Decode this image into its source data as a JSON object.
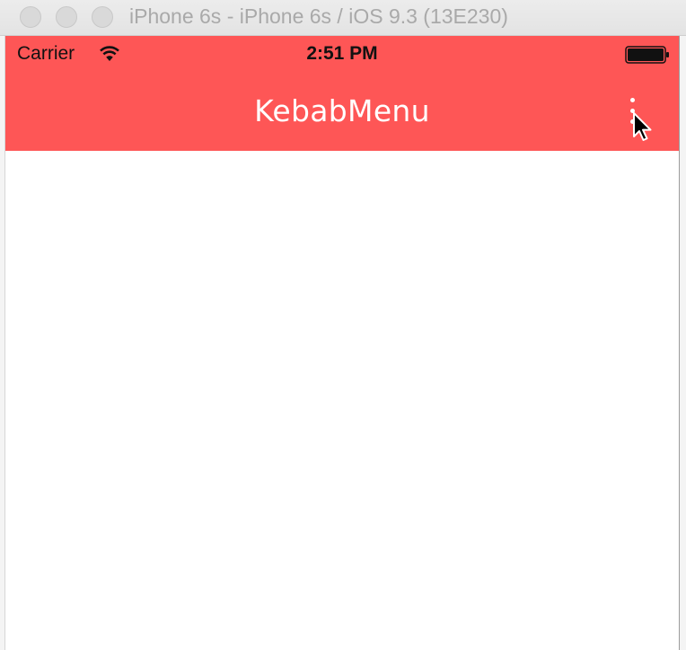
{
  "window": {
    "title": "iPhone 6s - iPhone 6s / iOS 9.3 (13E230)"
  },
  "statusbar": {
    "carrier": "Carrier",
    "time": "2:51 PM"
  },
  "navbar": {
    "title": "KebabMenu",
    "menu_icon": "kebab-menu-icon"
  },
  "colors": {
    "navbar_background": "#fe5656",
    "navbar_text": "#ffffff",
    "content_background": "#ffffff"
  }
}
